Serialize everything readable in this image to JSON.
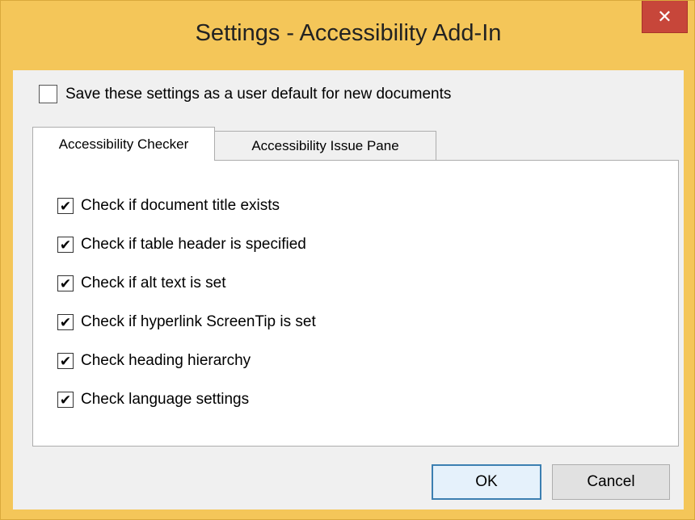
{
  "window": {
    "title": "Settings - Accessibility Add-In",
    "close_label": "✕"
  },
  "default_setting": {
    "label": "Save these settings as a user default for new documents",
    "checked": false
  },
  "tabs": [
    {
      "label": "Accessibility Checker",
      "active": true
    },
    {
      "label": "Accessibility Issue Pane",
      "active": false
    }
  ],
  "checks": [
    {
      "label": "Check if document title exists",
      "checked": true,
      "mark": "✔"
    },
    {
      "label": "Check if table header is specified",
      "checked": true,
      "mark": "✔"
    },
    {
      "label": "Check if alt text is set",
      "checked": true,
      "mark": "✔"
    },
    {
      "label": "Check if hyperlink ScreenTip is set",
      "checked": true,
      "mark": "✔"
    },
    {
      "label": "Check heading hierarchy",
      "checked": true,
      "mark": "✔"
    },
    {
      "label": "Check language settings",
      "checked": true,
      "mark": "✔"
    }
  ],
  "buttons": {
    "ok": "OK",
    "cancel": "Cancel"
  },
  "colors": {
    "frame": "#f4c659",
    "close": "#c7463a",
    "default_button_border": "#3c7fb1"
  }
}
